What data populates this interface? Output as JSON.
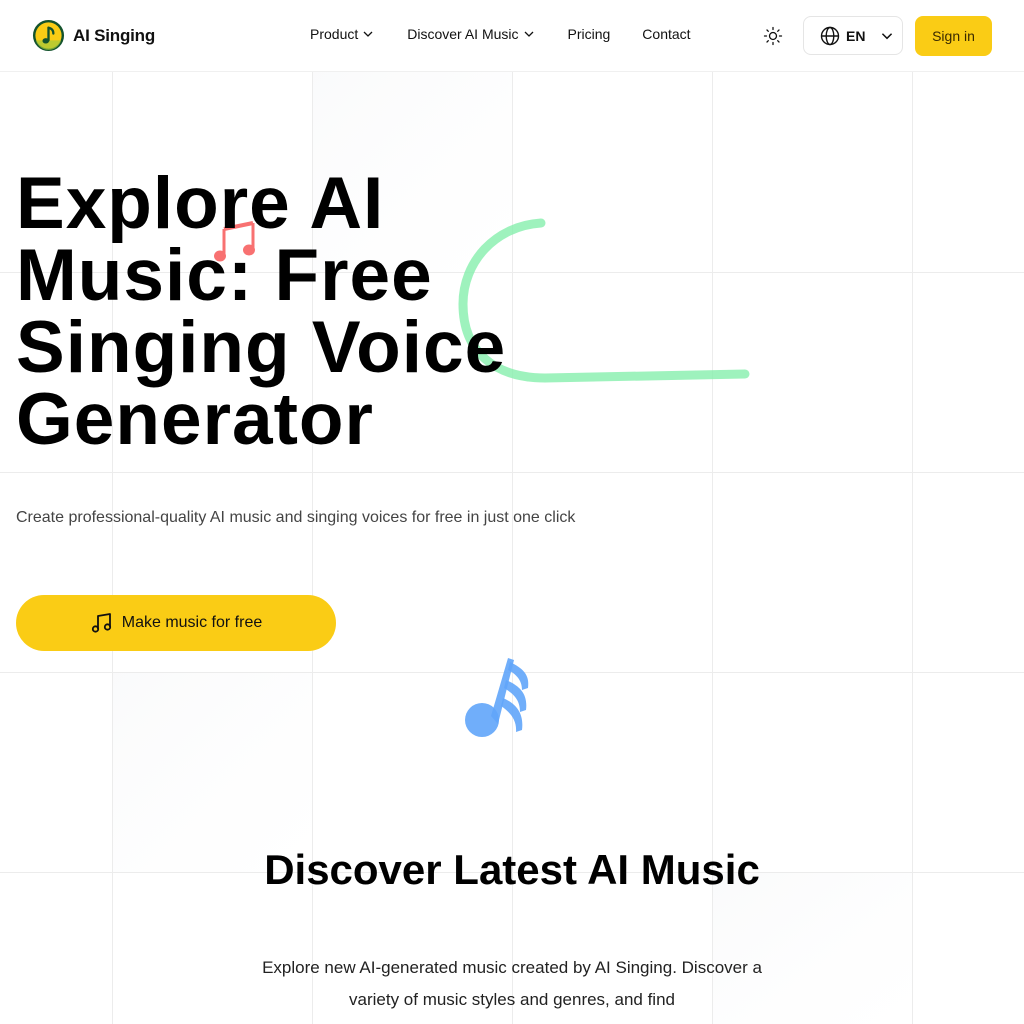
{
  "brand": {
    "name": "AI Singing",
    "logo_icon": "music-note-logo-icon"
  },
  "nav": {
    "items": [
      {
        "label": "Product",
        "has_dropdown": true
      },
      {
        "label": "Discover AI Music",
        "has_dropdown": true
      },
      {
        "label": "Pricing",
        "has_dropdown": false
      },
      {
        "label": "Contact",
        "has_dropdown": false
      }
    ],
    "theme_icon": "sun-icon",
    "language": {
      "label": "EN",
      "icon": "globe-icon"
    },
    "signin_label": "Sign in"
  },
  "hero": {
    "title": "Explore AI Music: Free Singing Voice Generator",
    "subtitle": "Create professional-quality AI music and singing voices for free in just one click",
    "cta_label": "Make music for free",
    "cta_icon": "music-note-icon"
  },
  "discover": {
    "title": "Discover Latest AI Music",
    "description": "Explore new AI-generated music created by AI Singing. Discover a variety of music styles and genres, and find"
  },
  "colors": {
    "accent": "#facc15",
    "green_stroke": "#86efac",
    "red_note": "#f87171",
    "blue_note": "#60a5fa"
  }
}
